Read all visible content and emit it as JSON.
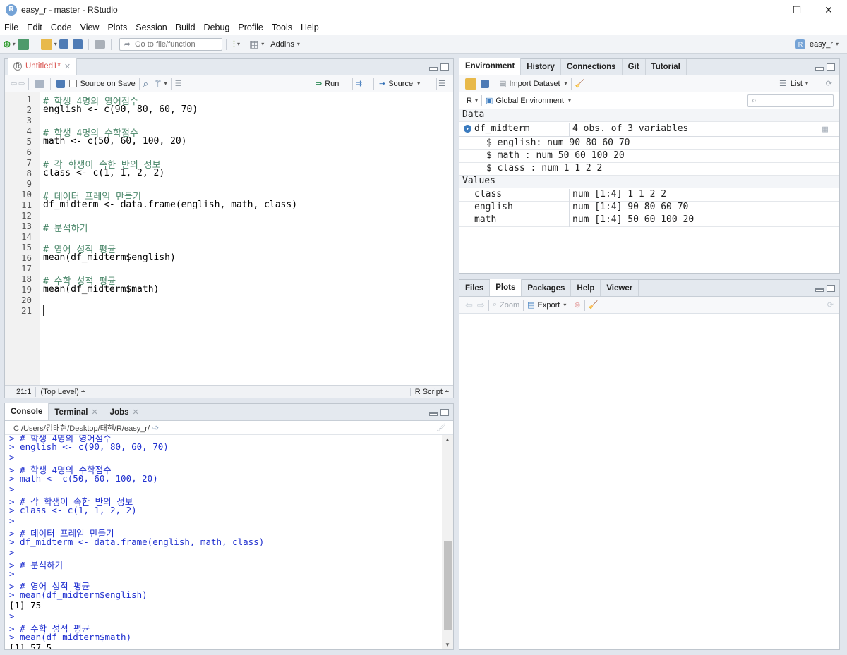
{
  "window": {
    "title": "easy_r - master - RStudio",
    "minimize": "—",
    "maximize": "☐",
    "close": "✕"
  },
  "menu": [
    "File",
    "Edit",
    "Code",
    "View",
    "Plots",
    "Session",
    "Build",
    "Debug",
    "Profile",
    "Tools",
    "Help"
  ],
  "toolbar": {
    "goto_placeholder": "Go to file/function",
    "addins": "Addins",
    "project": "easy_r"
  },
  "editor": {
    "tab": "Untitled1*",
    "source_on_save": "Source on Save",
    "run": "Run",
    "source": "Source",
    "lines": [
      {
        "n": "1",
        "t": "# 학생 4명의 영어점수",
        "k": "c"
      },
      {
        "n": "2",
        "t": "english <- c(90, 80, 60, 70)",
        "k": "x"
      },
      {
        "n": "3",
        "t": "",
        "k": "x"
      },
      {
        "n": "4",
        "t": "# 학생 4명의 수학점수",
        "k": "c"
      },
      {
        "n": "5",
        "t": "math <- c(50, 60, 100, 20)",
        "k": "x"
      },
      {
        "n": "6",
        "t": "",
        "k": "x"
      },
      {
        "n": "7",
        "t": "# 각 학생이 속한 반의 정보",
        "k": "c"
      },
      {
        "n": "8",
        "t": "class <- c(1, 1, 2, 2)",
        "k": "x"
      },
      {
        "n": "9",
        "t": "",
        "k": "x"
      },
      {
        "n": "10",
        "t": "# 데이터 프레임 만들기",
        "k": "c"
      },
      {
        "n": "11",
        "t": "df_midterm <- data.frame(english, math, class)",
        "k": "x"
      },
      {
        "n": "12",
        "t": "",
        "k": "x"
      },
      {
        "n": "13",
        "t": "# 분석하기",
        "k": "c"
      },
      {
        "n": "14",
        "t": "",
        "k": "x"
      },
      {
        "n": "15",
        "t": "# 영어 성적 평균",
        "k": "c"
      },
      {
        "n": "16",
        "t": "mean(df_midterm$english)",
        "k": "x"
      },
      {
        "n": "17",
        "t": "",
        "k": "x"
      },
      {
        "n": "18",
        "t": "# 수학 성적 평균",
        "k": "c"
      },
      {
        "n": "19",
        "t": "mean(df_midterm$math)",
        "k": "x"
      },
      {
        "n": "20",
        "t": "",
        "k": "x"
      },
      {
        "n": "21",
        "t": "",
        "k": "x"
      }
    ],
    "status_pos": "21:1",
    "status_level": "(Top Level) ÷",
    "status_type": "R Script ÷"
  },
  "console": {
    "tabs": [
      "Console",
      "Terminal",
      "Jobs"
    ],
    "path": "C:/Users/김태현/Desktop/태현/R/easy_r/",
    "lines": [
      {
        "t": "> # 학생 4명의 영어점수",
        "k": "b"
      },
      {
        "t": "> english <- c(90, 80, 60, 70)",
        "k": "b"
      },
      {
        "t": ">",
        "k": "b"
      },
      {
        "t": "> # 학생 4명의 수학점수",
        "k": "b"
      },
      {
        "t": "> math <- c(50, 60, 100, 20)",
        "k": "b"
      },
      {
        "t": ">",
        "k": "b"
      },
      {
        "t": "> # 각 학생이 속한 반의 정보",
        "k": "b"
      },
      {
        "t": "> class <- c(1, 1, 2, 2)",
        "k": "b"
      },
      {
        "t": ">",
        "k": "b"
      },
      {
        "t": "> # 데이터 프레임 만들기",
        "k": "b"
      },
      {
        "t": "> df_midterm <- data.frame(english, math, class)",
        "k": "b"
      },
      {
        "t": ">",
        "k": "b"
      },
      {
        "t": "> # 분석하기",
        "k": "b"
      },
      {
        "t": ">",
        "k": "b"
      },
      {
        "t": "> # 영어 성적 평균",
        "k": "b"
      },
      {
        "t": "> mean(df_midterm$english)",
        "k": "b"
      },
      {
        "t": "[1] 75",
        "k": "k"
      },
      {
        "t": ">",
        "k": "b"
      },
      {
        "t": "> # 수학 성적 평균",
        "k": "b"
      },
      {
        "t": "> mean(df_midterm$math)",
        "k": "b"
      },
      {
        "t": "[1] 57.5",
        "k": "k"
      }
    ]
  },
  "environment": {
    "tabs": [
      "Environment",
      "History",
      "Connections",
      "Git",
      "Tutorial"
    ],
    "import": "Import Dataset",
    "list": "List",
    "r": "R",
    "global": "Global Environment",
    "data_header": "Data",
    "df_name": "df_midterm",
    "df_desc": "4 obs. of 3 variables",
    "df_cols": [
      "$ english: num  90 80 60 70",
      "$ math   : num  50 60 100 20",
      "$ class  : num  1 1 2 2"
    ],
    "values_header": "Values",
    "values": [
      {
        "name": "class",
        "val": "num [1:4] 1 1 2 2"
      },
      {
        "name": "english",
        "val": "num [1:4] 90 80 60 70"
      },
      {
        "name": "math",
        "val": "num [1:4] 50 60 100 20"
      }
    ]
  },
  "files": {
    "tabs": [
      "Files",
      "Plots",
      "Packages",
      "Help",
      "Viewer"
    ],
    "zoom": "Zoom",
    "export": "Export"
  }
}
